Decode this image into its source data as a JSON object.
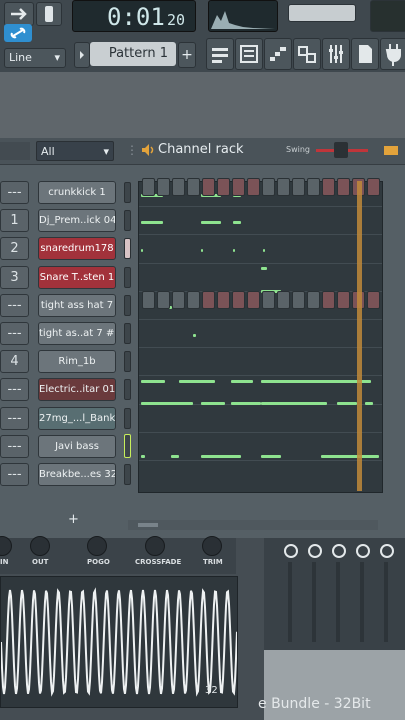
{
  "toolbar": {
    "snap_label": "Line",
    "time": "0:01",
    "time_fraction": "20",
    "pattern": "Pattern 1",
    "pattern_add": "+",
    "icons": [
      "playlist-icon",
      "channel-rack-icon",
      "piano-roll-icon",
      "plugin-picker-icon",
      "mixer-icon",
      "browser-icon",
      "plug-icon",
      "more-icon"
    ]
  },
  "rack": {
    "filter": "All",
    "title": "Channel rack",
    "swing_label": "Swing",
    "add_label": "+"
  },
  "channels": [
    {
      "num": "---",
      "name": "crunkkick 1",
      "style": "normal"
    },
    {
      "num": "1",
      "name": "Dj_Prem..ick 04",
      "style": "normal"
    },
    {
      "num": "2",
      "name": "snaredrum178",
      "style": "red"
    },
    {
      "num": "3",
      "name": "Snare T..sten 1",
      "style": "red"
    },
    {
      "num": "---",
      "name": "tight ass hat 7",
      "style": "normal"
    },
    {
      "num": "---",
      "name": "tight as..at 7 #2",
      "style": "normal"
    },
    {
      "num": "4",
      "name": "Rim_1b",
      "style": "normal"
    },
    {
      "num": "---",
      "name": "Electric..itar 01",
      "style": "darkred"
    },
    {
      "num": "---",
      "name": "27mg_...l_Bank",
      "style": "teal"
    },
    {
      "num": "---",
      "name": "Javi bass",
      "style": "normal"
    },
    {
      "num": "---",
      "name": "Breakbe...es 32",
      "style": "normal"
    }
  ],
  "knobs": {
    "labels": [
      "IN",
      "OUT",
      "POGO",
      "CROSSFADE",
      "TRIM"
    ]
  },
  "plugin": {
    "title": "e Bundle - 32Bit",
    "scope_badge": "32"
  },
  "colors": {
    "note": "#8ee38f",
    "playhead": "#c08a3a",
    "selected_red": "#a2323b"
  }
}
